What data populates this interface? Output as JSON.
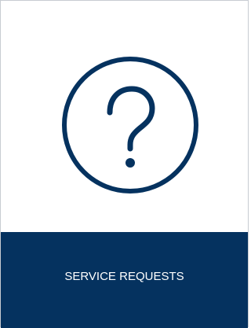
{
  "tile": {
    "label": "SERVICE REQUESTS",
    "icon": "question-mark-circle-icon",
    "icon_color": "#05325f",
    "bar_color": "#05325f",
    "text_color": "#ffffff"
  }
}
